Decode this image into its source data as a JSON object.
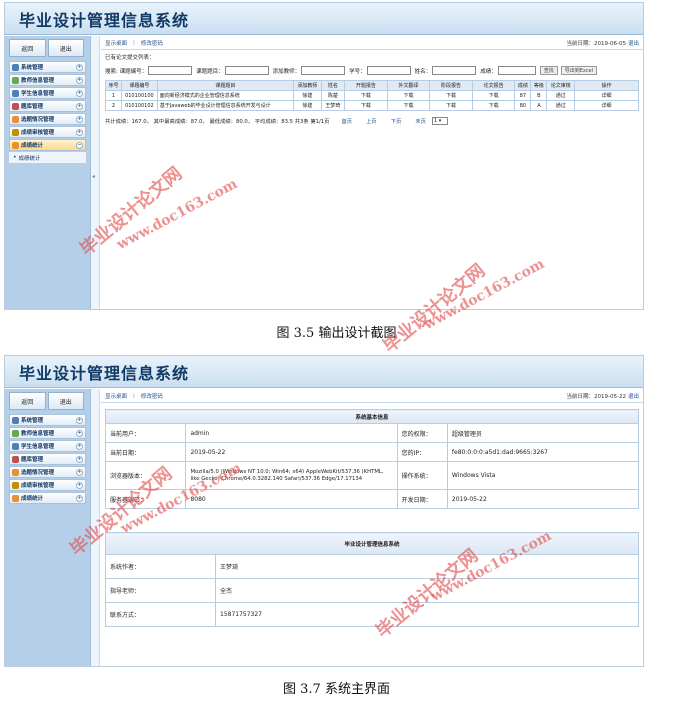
{
  "app_title": "毕业设计管理信息系统",
  "sidebar": {
    "return_label": "返回",
    "logout_label": "退出",
    "items": [
      {
        "label": "系统管理",
        "color": "#4d7fb8"
      },
      {
        "label": "教师信息管理",
        "color": "#6aa84f"
      },
      {
        "label": "学生信息管理",
        "color": "#4d7fb8"
      },
      {
        "label": "题库管理",
        "color": "#c0504d"
      },
      {
        "label": "选题情况管理",
        "color": "#e69138"
      },
      {
        "label": "成绩审核管理",
        "color": "#bf9000"
      },
      {
        "label": "成绩统计",
        "color": "#e69138"
      }
    ],
    "sub_item_label": "成绩统计"
  },
  "shot1": {
    "topbar": {
      "desktop_link": "显示桌面",
      "password_link": "修改密码",
      "date_label": "当前日期：2019-06-05",
      "logout_link": "退出"
    },
    "section_title": "已有论文提交列表：",
    "search": {
      "prefix": "搜索:",
      "title_no_label": "课题编号：",
      "title_label": "课题题目：",
      "teacher_label": "添加教师：",
      "student_no_label": "学号：",
      "name_label": "姓名：",
      "score_label": "成绩：",
      "query_button": "查找",
      "export_button": "导出到Excel"
    },
    "table": {
      "headers": [
        "序号",
        "课题编号",
        "课题题目",
        "添加教师",
        "姓名",
        "开题报告",
        "外文翻译",
        "阶段报告",
        "论文报告",
        "成绩",
        "等级",
        "论文审核",
        "操作"
      ],
      "rows": [
        [
          "1",
          "010100100",
          "面向新经济模式的企业管理信息系统",
          "徐建",
          "陈楚",
          "下载",
          "下载",
          "下载",
          "下载",
          "87",
          "B",
          "通过",
          "详细"
        ],
        [
          "2",
          "010100102",
          "基于Javaweb的毕业设计管理信息系统开发与设计",
          "徐建",
          "王梦琦",
          "下载",
          "下载",
          "下载",
          "下载",
          "80",
          "A",
          "通过",
          "详细"
        ]
      ]
    },
    "pager": {
      "summary": "共计成绩：167.0，  其中最高成绩：87.0，  最低成绩：80.0，  平均成绩：83.5  共3条  第1/1页",
      "first": "首页",
      "prev": "上页",
      "next": "下页",
      "last": "末页",
      "page_select": "1"
    }
  },
  "caption1": "图 3.5  输出设计截图",
  "shot2": {
    "topbar": {
      "desktop_link": "显示桌面",
      "password_link": "修改密码",
      "date_label": "当前日期：2019-05-22",
      "logout_link": "退出"
    },
    "sysinfo_title": "系统基本信息",
    "sysinfo": {
      "current_user_label": "当前用户：",
      "current_user": "admin",
      "permission_label": "您的权限：",
      "permission": "超级管理员",
      "current_date_label": "当前日期：",
      "current_date": "2019-05-22",
      "ip_label": "您的IP：",
      "ip": "fe80:0:0:0:a5d1:dad:9665:3267",
      "browser_label": "浏览器版本：",
      "browser": "Mozilla/5.0 (Windows NT 10.0; Win64; x64) AppleWebKit/537.36 (KHTML, like Gecko) Chrome/64.0.3282.140 Safari/537.36 Edge/17.17134",
      "os_label": "操作系统：",
      "os": "Windows Vista",
      "port_label": "服务器端口：",
      "port": "8080",
      "dev_date_label": "开发日期：",
      "dev_date": "2019-05-22"
    },
    "about_title": "毕业设计管理信息系统",
    "about": {
      "author_label": "系统作者：",
      "author": "王梦琦",
      "advisor_label": "指导老师：",
      "advisor": "全杰",
      "contact_label": "联系方式：",
      "contact": "15871757327"
    }
  },
  "caption2": "图 3.7  系统主界面",
  "watermark": {
    "cn": "毕业设计论文网",
    "url": "www.doc163.com"
  }
}
